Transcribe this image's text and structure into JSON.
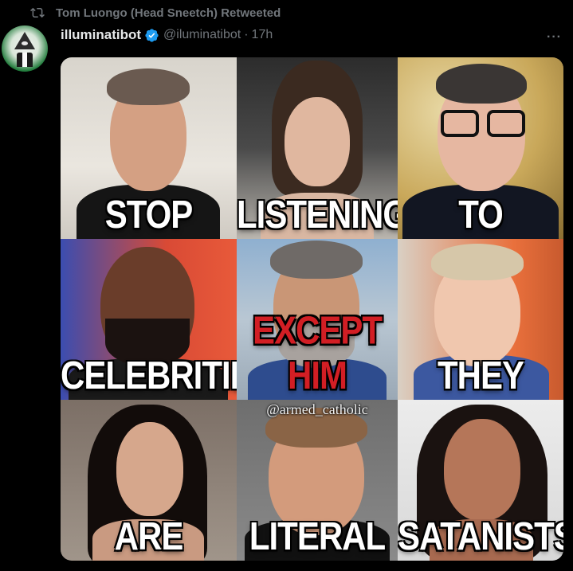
{
  "retweet": {
    "label": "Tom Luongo (Head Sneetch) Retweeted"
  },
  "tweet": {
    "display_name": "illuminatibot",
    "handle": "@iluminatibot",
    "separator": "·",
    "time": "17h",
    "more_label": "···"
  },
  "image": {
    "watermark": "@armed_catholic",
    "captions": [
      "STOP",
      "LISTENING",
      "TO",
      "CELEBRITIES",
      "EXCEPT HIM",
      "THEY",
      "ARE",
      "LITERAL",
      "SATANISTS"
    ]
  },
  "colors": {
    "background": "#000000",
    "text_primary": "#e7e9ea",
    "text_secondary": "#71767b",
    "verified_blue": "#1d9bf0",
    "caption_red": "#d21e24"
  },
  "icons": [
    "retweet-icon",
    "verified-badge-icon",
    "more-icon"
  ]
}
